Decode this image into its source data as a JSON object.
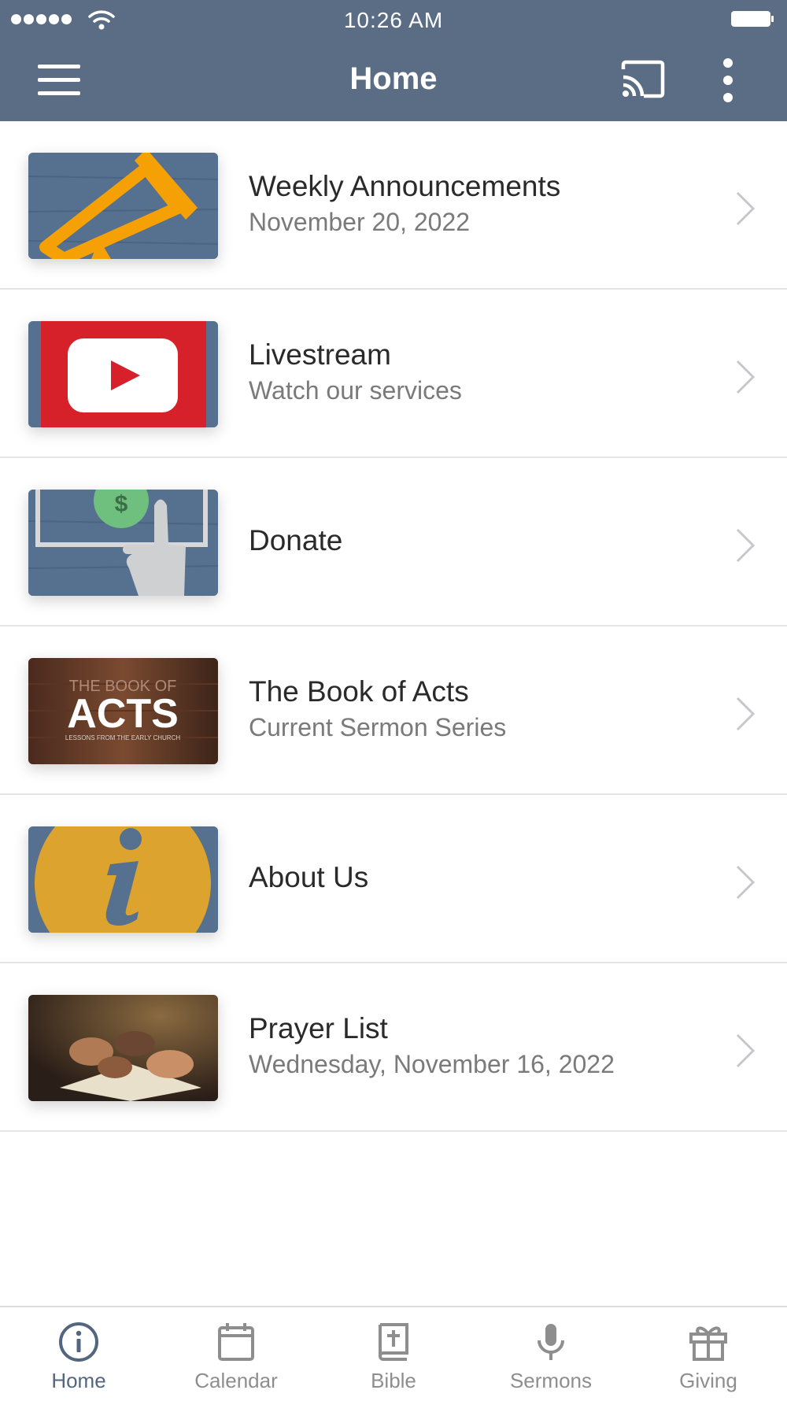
{
  "status_bar": {
    "time": "10:26 AM"
  },
  "header": {
    "title": "Home"
  },
  "items": [
    {
      "title": "Weekly Announcements",
      "subtitle": "November 20, 2022",
      "thumbnail": "megaphone"
    },
    {
      "title": "Livestream",
      "subtitle": "Watch our services",
      "thumbnail": "youtube"
    },
    {
      "title": "Donate",
      "subtitle": "",
      "thumbnail": "donate-hand"
    },
    {
      "title": "The Book of Acts",
      "subtitle": "Current Sermon Series",
      "thumbnail": "acts-sermon",
      "thumbnail_text": {
        "top": "THE BOOK OF",
        "main": "ACTS",
        "bottom": "LESSONS FROM THE EARLY CHURCH"
      }
    },
    {
      "title": "About Us",
      "subtitle": "",
      "thumbnail": "info"
    },
    {
      "title": "Prayer List",
      "subtitle": "Wednesday, November 16, 2022",
      "thumbnail": "praying-hands-photo"
    }
  ],
  "tabs": [
    {
      "label": "Home",
      "icon": "info-circle-icon",
      "active": true
    },
    {
      "label": "Calendar",
      "icon": "calendar-icon",
      "active": false
    },
    {
      "label": "Bible",
      "icon": "bible-icon",
      "active": false
    },
    {
      "label": "Sermons",
      "icon": "microphone-icon",
      "active": false
    },
    {
      "label": "Giving",
      "icon": "gift-icon",
      "active": false
    }
  ],
  "colors": {
    "header_bg": "#5a6d84",
    "accent": "#52667f",
    "tab_inactive": "#8e8e8e",
    "youtube_red": "#d6212a",
    "megaphone_orange": "#f5a105",
    "info_gold": "#dca42e"
  }
}
